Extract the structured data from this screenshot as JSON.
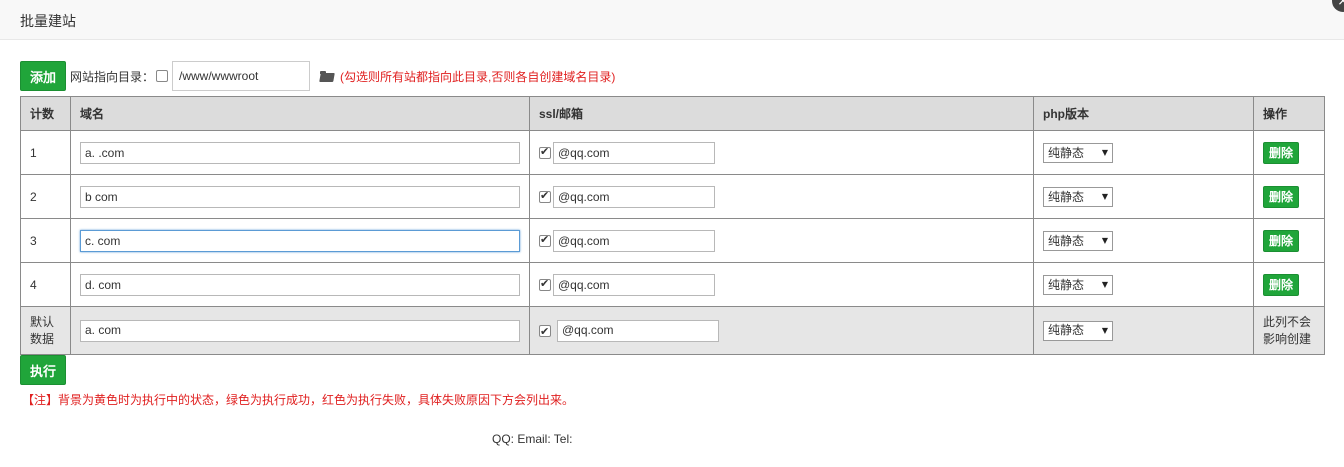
{
  "dialog": {
    "title": "批量建站",
    "close_glyph": "×"
  },
  "toolbar": {
    "add_label": "添加",
    "dir_label": "网站指向目录：",
    "dir_value": "/www/wwwroot",
    "dir_hint": "(勾选则所有站都指向此目录,否则各自创建域名目录)"
  },
  "table": {
    "headers": {
      "count": "计数",
      "domain": "域名",
      "ssl": "ssl/邮箱",
      "php": "php版本",
      "action": "操作"
    },
    "rows": [
      {
        "count": "1",
        "domain": "a.        .com",
        "email": "              @qq.com",
        "php": "纯静态",
        "action": "删除"
      },
      {
        "count": "2",
        "domain": "b           com",
        "email": "              @qq.com",
        "php": "纯静态",
        "action": "删除"
      },
      {
        "count": "3",
        "domain": "c.          com",
        "email": "              @qq.com",
        "php": "纯静态",
        "action": "删除"
      },
      {
        "count": "4",
        "domain": "d.          com",
        "email": "              @qq.com",
        "php": "纯静态",
        "action": "删除"
      }
    ],
    "default_row": {
      "label_line1": "默认",
      "label_line2": "数据",
      "domain": "a.          com",
      "email": "              @qq.com",
      "php": "纯静态",
      "note_line1": "此列不会",
      "note_line2": "影响创建"
    }
  },
  "run_label": "执行",
  "note": "【注】背景为黄色时为执行中的状态，绿色为执行成功，红色为执行失败，具体失败原因下方会列出来。",
  "footer": {
    "text": "QQ:             Email:                       Tel:"
  }
}
